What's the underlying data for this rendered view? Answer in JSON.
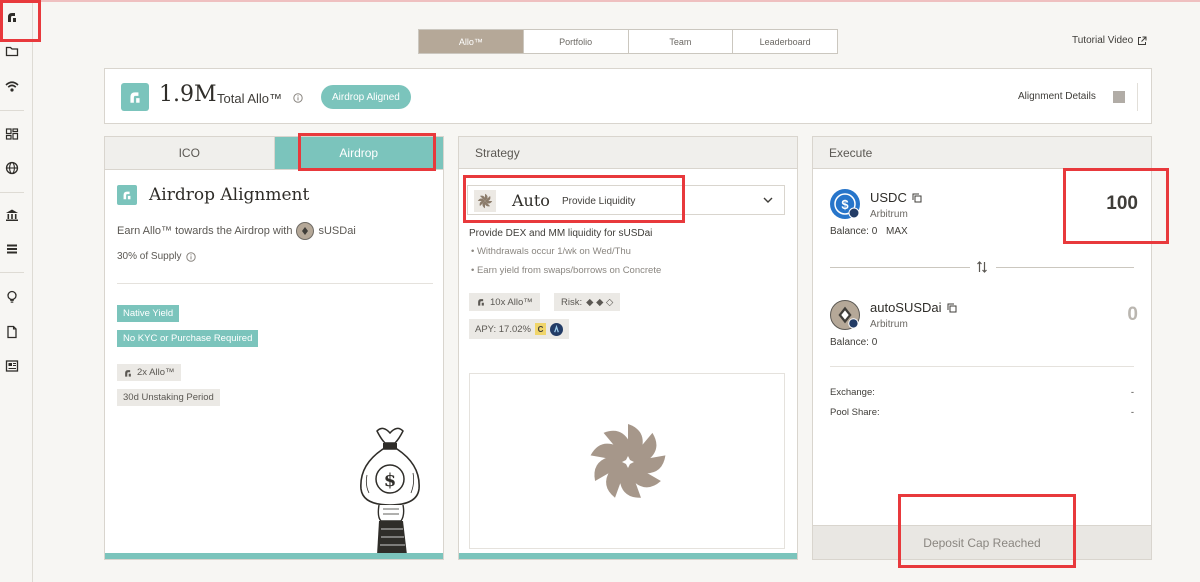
{
  "top_tabs": [
    {
      "label": "Allo™",
      "active": true
    },
    {
      "label": "Portfolio",
      "active": false
    },
    {
      "label": "Team",
      "active": false
    },
    {
      "label": "Leaderboard",
      "active": false
    }
  ],
  "tutorial_label": "Tutorial Video",
  "sidebar": {
    "icons": [
      "allo-logo-icon",
      "folder-icon",
      "wifi-icon",
      "dashboard-icon",
      "globe-icon",
      "bank-icon",
      "stack-icon",
      "lightbulb-icon",
      "document-icon",
      "newspaper-icon"
    ]
  },
  "summary": {
    "amount": "1.9M",
    "label": "Total Allo™",
    "status_pill": "Airdrop Aligned",
    "alignment_details": "Alignment Details"
  },
  "left_panel": {
    "tabs": [
      "ICO",
      "Airdrop"
    ],
    "active_tab": "Airdrop",
    "title": "Airdrop Alignment",
    "earn_text": "Earn Allo™ towards the Airdrop with",
    "earn_token": "sUSDai",
    "supply_text": "30% of Supply",
    "teal_tags": [
      "Native Yield",
      "No KYC or Purchase Required"
    ],
    "grey_tags": [
      "2x Allo™",
      "30d Unstaking Period"
    ],
    "moneybag_symbol": "$"
  },
  "middle_panel": {
    "header": "Strategy",
    "strategy_name": "Auto",
    "strategy_subtitle": "Provide Liquidity",
    "description": "Provide DEX and MM liquidity for sUSDai",
    "bullets": [
      "Withdrawals occur 1/wk on Wed/Thu",
      "Earn yield from swaps/borrows on Concrete"
    ],
    "multiplier_chip": "10x Allo™",
    "risk_label": "Risk:",
    "risk_symbols": "◆ ◆ ◇",
    "apy_chip": "APY: 17.02%",
    "apy_c_icon": "C"
  },
  "right_panel": {
    "header": "Execute",
    "from_asset": {
      "symbol": "USDC",
      "chain": "Arbitrum",
      "balance_label": "Balance: 0",
      "max_label": "MAX",
      "amount": "100"
    },
    "to_asset": {
      "symbol": "autoSUSDai",
      "chain": "Arbitrum",
      "balance_label": "Balance: 0",
      "amount": "0"
    },
    "rows": [
      {
        "label": "Exchange:",
        "value": "-"
      },
      {
        "label": "Pool Share:",
        "value": "-"
      }
    ],
    "action_button": "Deposit Cap Reached"
  },
  "colors": {
    "accent": "#7bc4bc",
    "tab_active": "#b5a898",
    "highlight_box": "#e8393c"
  }
}
